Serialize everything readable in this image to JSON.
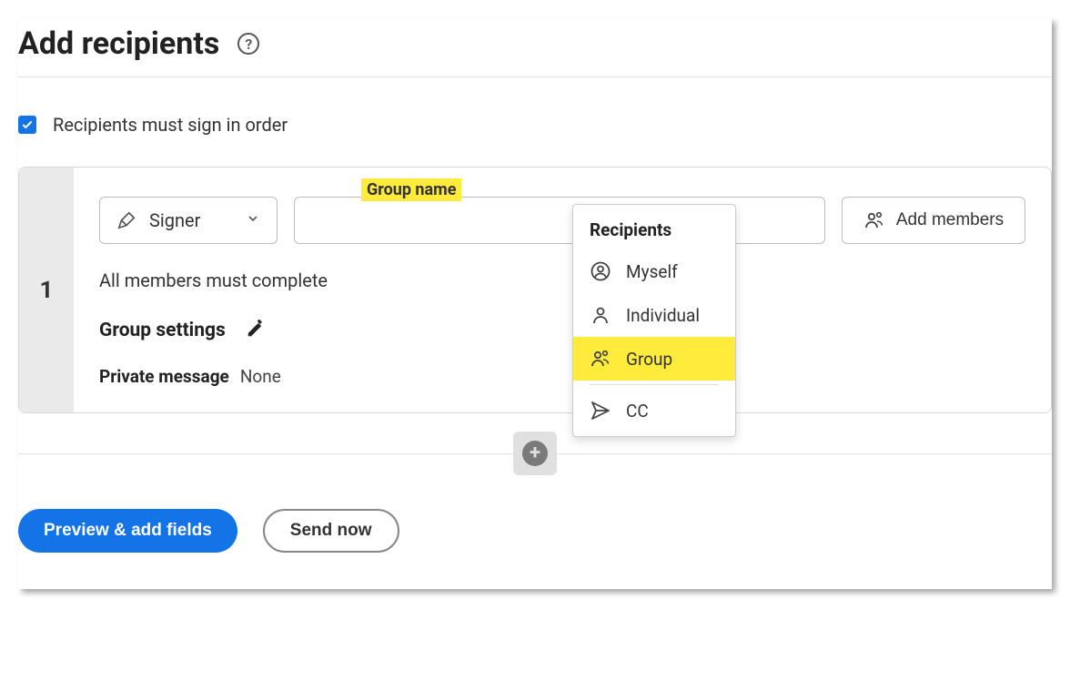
{
  "header": {
    "title": "Add recipients"
  },
  "sign_order": {
    "label": "Recipients must sign in order",
    "checked": true
  },
  "recipient": {
    "index": "1",
    "group_name_label": "Group name",
    "role": "Signer",
    "group_name_value": "",
    "add_members_label": "Add members",
    "note": "All members must complete",
    "settings_label": "Group settings",
    "pm_label": "Private message",
    "pm_value": "None"
  },
  "dropdown": {
    "header": "Recipients",
    "items": [
      {
        "icon": "myself",
        "label": "Myself",
        "highlighted": false
      },
      {
        "icon": "individual",
        "label": "Individual",
        "highlighted": false
      },
      {
        "icon": "group",
        "label": "Group",
        "highlighted": true
      },
      {
        "icon": "cc",
        "label": "CC",
        "highlighted": false
      }
    ]
  },
  "actions": {
    "primary": "Preview & add fields",
    "secondary": "Send now"
  }
}
